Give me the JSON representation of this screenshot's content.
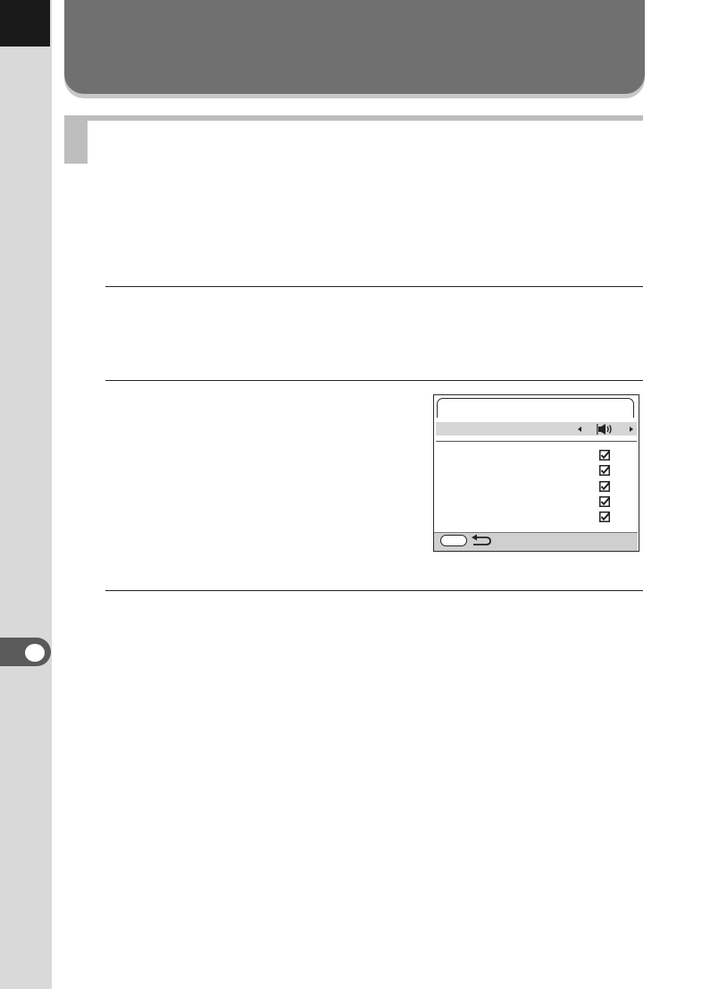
{
  "page": {
    "chapter_tab_color": "#5a5a5a",
    "header_banner_color": "#707070",
    "section_marker_color": "#bdbdbd"
  },
  "camera_screen": {
    "tab_icon": "tab-shape",
    "speaker_icon": "speaker-volume-icon",
    "checkbox_icon": "checked-box-icon",
    "back_icon": "return-arrow-icon",
    "checkboxes_checked": [
      true,
      true,
      true,
      true,
      true
    ]
  }
}
